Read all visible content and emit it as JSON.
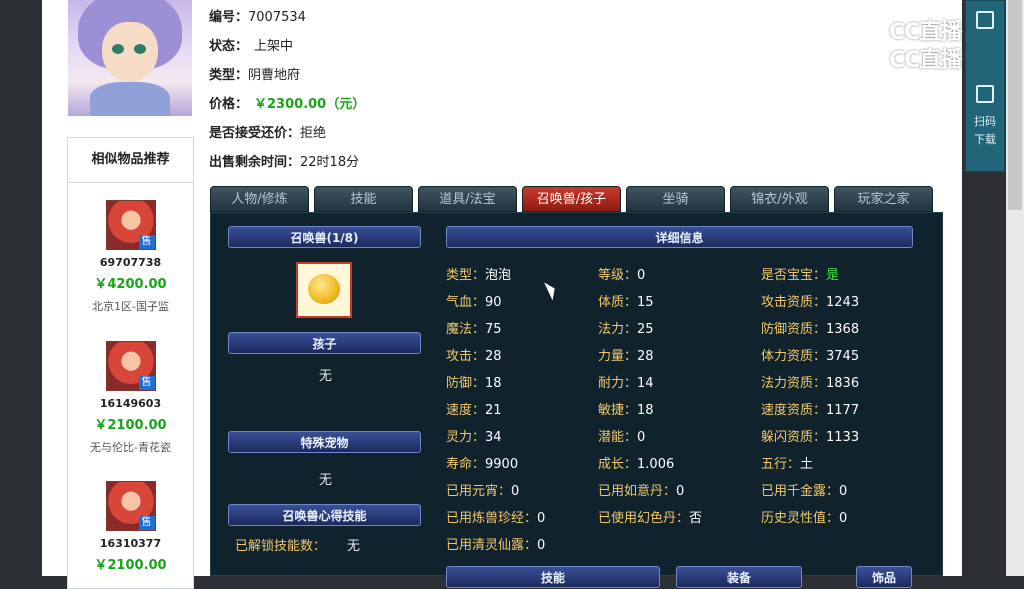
{
  "item": {
    "id_label": "编号：",
    "id": "7007534",
    "status_label": "状态：",
    "status": "上架中",
    "type_label": "类型：",
    "type": "阴曹地府",
    "price_label": "价格：",
    "price": "￥2300.00（元）",
    "bargain_label": "是否接受还价：",
    "bargain": "拒绝",
    "time_label": "出售剩余时间：",
    "time_left": "22时18分"
  },
  "similar": {
    "title": "相似物品推荐",
    "sale_tag": "售",
    "items": [
      {
        "id": "69707738",
        "price": "￥4200.00",
        "server": "北京1区-国子监"
      },
      {
        "id": "16149603",
        "price": "￥2100.00",
        "server": "无与伦比-青花瓷"
      },
      {
        "id": "16310377",
        "price": "￥2100.00",
        "server": ""
      }
    ]
  },
  "tabs": [
    {
      "label": "人物/修炼",
      "active": false
    },
    {
      "label": "技能",
      "active": false
    },
    {
      "label": "道具/法宝",
      "active": false
    },
    {
      "label": "召唤兽/孩子",
      "active": true
    },
    {
      "label": "坐骑",
      "active": false
    },
    {
      "label": "锦衣/外观",
      "active": false
    },
    {
      "label": "玩家之家",
      "active": false
    }
  ],
  "panel": {
    "pet_header": "召唤兽(1/8)",
    "child_header": "孩子",
    "child_value": "无",
    "special_header": "特殊宠物",
    "special_value": "无",
    "heart_header": "召唤兽心得技能",
    "heart_label": "已解锁技能数：",
    "heart_value": "无",
    "detail_header": "详细信息",
    "bottom_headers": [
      "技能",
      "装备",
      "饰品"
    ]
  },
  "stats": [
    [
      {
        "k": "类型：",
        "v": "泡泡"
      },
      {
        "k": "等级：",
        "v": "0"
      },
      {
        "k": "是否宝宝：",
        "v": "是",
        "green": true
      }
    ],
    [
      {
        "k": "气血：",
        "v": "90"
      },
      {
        "k": "体质：",
        "v": "15"
      },
      {
        "k": "攻击资质：",
        "v": "1243"
      }
    ],
    [
      {
        "k": "魔法：",
        "v": "75"
      },
      {
        "k": "法力：",
        "v": "25"
      },
      {
        "k": "防御资质：",
        "v": "1368"
      }
    ],
    [
      {
        "k": "攻击：",
        "v": "28"
      },
      {
        "k": "力量：",
        "v": "28"
      },
      {
        "k": "体力资质：",
        "v": "3745"
      }
    ],
    [
      {
        "k": "防御：",
        "v": "18"
      },
      {
        "k": "耐力：",
        "v": "14"
      },
      {
        "k": "法力资质：",
        "v": "1836"
      }
    ],
    [
      {
        "k": "速度：",
        "v": "21"
      },
      {
        "k": "敏捷：",
        "v": "18"
      },
      {
        "k": "速度资质：",
        "v": "1177"
      }
    ],
    [
      {
        "k": "灵力：",
        "v": "34"
      },
      {
        "k": "潜能：",
        "v": "0"
      },
      {
        "k": "躲闪资质：",
        "v": "1133"
      }
    ],
    [
      {
        "k": "寿命：",
        "v": "9900"
      },
      {
        "k": "成长：",
        "v": "1.006"
      },
      {
        "k": "五行：",
        "v": "土"
      }
    ],
    [
      {
        "k": "已用元宵：",
        "v": "0"
      },
      {
        "k": "已用如意丹：",
        "v": "0"
      },
      {
        "k": "已用千金露：",
        "v": "0"
      }
    ],
    [
      {
        "k": "已用炼兽珍经：",
        "v": "0"
      },
      {
        "k": "已使用幻色丹：",
        "v": "否"
      },
      {
        "k": "历史灵性值：",
        "v": "0"
      }
    ],
    [
      {
        "k": "已用清灵仙露：",
        "v": "0"
      }
    ]
  ],
  "right_widget": {
    "scan_label": "扫码",
    "download_label": "下载"
  },
  "logo_text": "CC直播"
}
